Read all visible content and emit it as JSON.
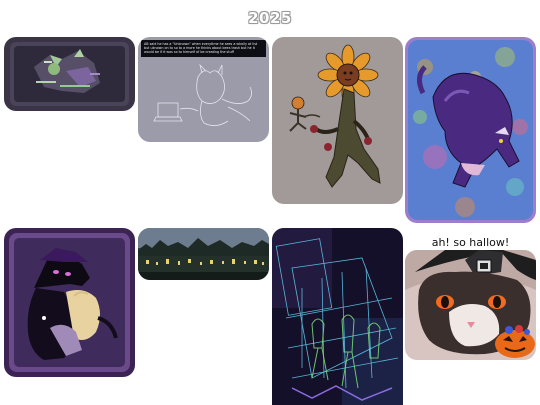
{
  "gallery": {
    "year_heading": "2025",
    "tiles": [
      {
        "name": "glitch-green-creature-art"
      },
      {
        "name": "sketch-cat-computer-art",
        "caption": "AB said he has a \"Unknown\" when everytime he sees a wholly at list but uknown on to so to a more he thinks about bees trash but he it would be if it was so to himself of be creating the stuff"
      },
      {
        "name": "sunflower-creature-art"
      },
      {
        "name": "purple-cat-leaping-art"
      },
      {
        "name": "hat-creature-duo-art"
      },
      {
        "name": "night-town-lights-art"
      },
      {
        "name": "neon-wireframe-figures-art"
      },
      {
        "name": "halloween-cat-art",
        "caption": "ah! so hallow!"
      }
    ]
  }
}
